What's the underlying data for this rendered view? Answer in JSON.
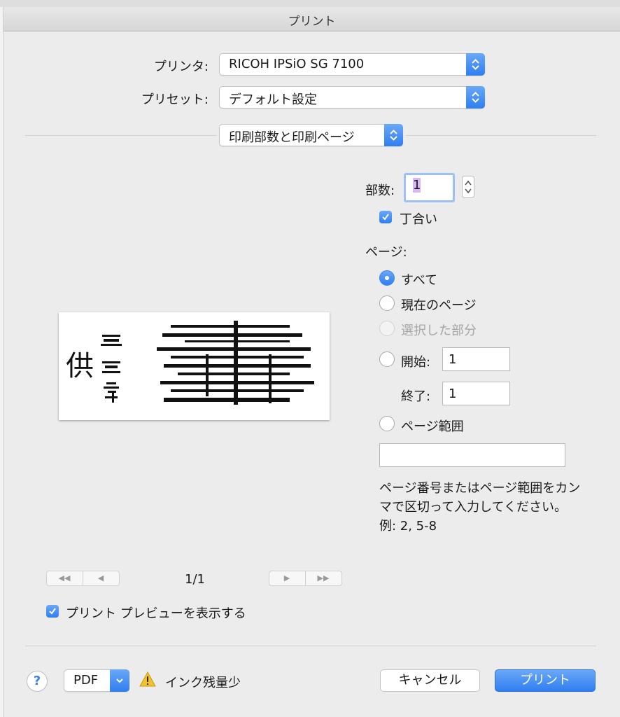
{
  "window": {
    "title": "プリント"
  },
  "printer": {
    "label": "プリンタ:",
    "value": "RICOH IPSiO SG 7100"
  },
  "preset": {
    "label": "プリセット:",
    "value": "デフォルト設定"
  },
  "section": {
    "value": "印刷部数と印刷ページ"
  },
  "copies": {
    "label": "部数:",
    "value": "1",
    "collate_label": "丁合い",
    "collate_checked": true
  },
  "pages": {
    "label": "ページ:",
    "options": [
      {
        "label": "すべて",
        "selected": true,
        "enabled": true
      },
      {
        "label": "現在のページ",
        "selected": false,
        "enabled": true
      },
      {
        "label": "選択した部分",
        "selected": false,
        "enabled": false
      },
      {
        "label": "開始:",
        "selected": false,
        "enabled": true
      },
      {
        "label": "ページ範囲",
        "selected": false,
        "enabled": true
      }
    ],
    "from_value": "1",
    "to_label": "終了:",
    "to_value": "1",
    "range_value": "",
    "hint": "ページ番号またはページ範囲をカンマで区切って入力してください。例: 2, 5-8"
  },
  "preview": {
    "page_indicator": "1/1",
    "show_preview_label": "プリント プレビューを表示する",
    "show_preview_checked": true
  },
  "footer": {
    "help_label": "?",
    "pdf_label": "PDF",
    "warning_text": "インク残量少",
    "cancel_label": "キャンセル",
    "print_label": "プリント"
  },
  "colors": {
    "accent": "#2f7ef0",
    "background": "#ececec"
  }
}
